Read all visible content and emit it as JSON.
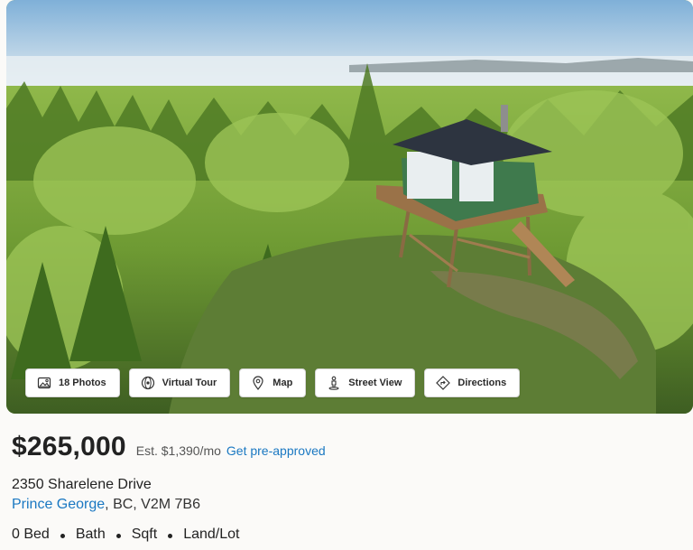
{
  "photo_buttons": [
    {
      "label": "18 Photos",
      "icon": "photo-icon"
    },
    {
      "label": "Virtual Tour",
      "icon": "virtual-tour-icon"
    },
    {
      "label": "Map",
      "icon": "map-pin-icon"
    },
    {
      "label": "Street View",
      "icon": "street-view-icon"
    },
    {
      "label": "Directions",
      "icon": "directions-icon"
    }
  ],
  "listing": {
    "price": "$265,000",
    "estimate": "Est. $1,390/mo",
    "preapproved_link": "Get pre-approved",
    "street": "2350 Sharelene Drive",
    "city": "Prince George",
    "region": ", BC, V2M 7B6",
    "facts": [
      "0 Bed",
      "Bath",
      "Sqft",
      "Land/Lot"
    ]
  },
  "colors": {
    "link": "#1a78c2",
    "text": "#222222",
    "background": "#fbfaf8"
  }
}
